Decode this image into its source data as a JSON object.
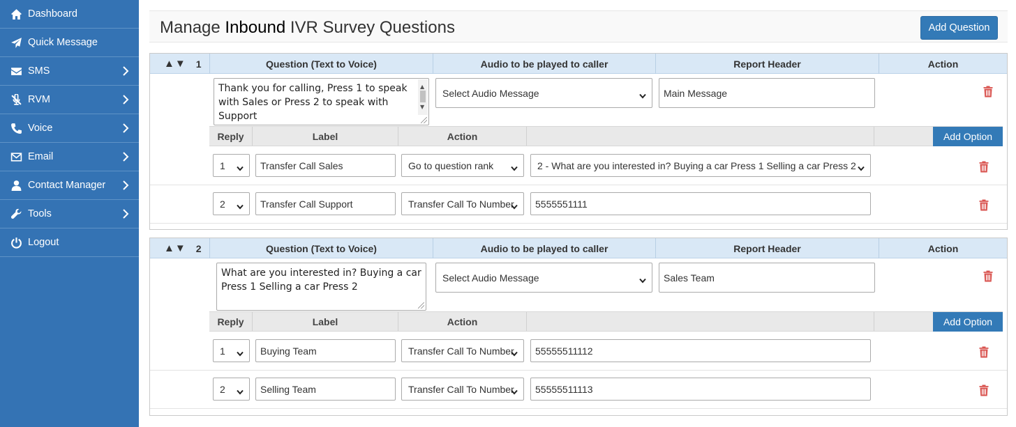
{
  "sidebar": {
    "items": [
      {
        "label": "Dashboard",
        "icon": "home-icon",
        "has_submenu": false
      },
      {
        "label": "Quick Message",
        "icon": "paper-plane-icon",
        "has_submenu": false
      },
      {
        "label": "SMS",
        "icon": "envelope-icon",
        "has_submenu": true
      },
      {
        "label": "RVM",
        "icon": "microphone-slash-icon",
        "has_submenu": true
      },
      {
        "label": "Voice",
        "icon": "phone-icon",
        "has_submenu": true
      },
      {
        "label": "Email",
        "icon": "envelope-outline-icon",
        "has_submenu": true
      },
      {
        "label": "Contact Manager",
        "icon": "user-icon",
        "has_submenu": true
      },
      {
        "label": "Tools",
        "icon": "wrench-icon",
        "has_submenu": true
      },
      {
        "label": "Logout",
        "icon": "power-icon",
        "has_submenu": false
      }
    ]
  },
  "header": {
    "title_part1": "Manage",
    "title_bold": "Inbound",
    "title_part2": "IVR Survey Questions",
    "add_question_label": "Add Question"
  },
  "columns": {
    "question": "Question (Text to Voice)",
    "audio": "Audio to be played to caller",
    "report": "Report Header",
    "action": "Action"
  },
  "option_columns": {
    "reply": "Reply",
    "label": "Label",
    "action": "Action",
    "add_option_label": "Add Option"
  },
  "questions": [
    {
      "rank": "1",
      "arrows": "▲▼",
      "text": "Thank you for calling, Press 1 to speak with Sales or Press 2 to speak with Support",
      "audio": "Select Audio Message",
      "report_header": "Main Message",
      "options": [
        {
          "reply": "1",
          "label": "Transfer Call Sales",
          "action": "Go to question rank",
          "target": "2 - What are you interested in? Buying a car Press 1 Selling a car Press 2"
        },
        {
          "reply": "2",
          "label": "Transfer Call Support",
          "action": "Transfer Call To Number",
          "target": "5555551111"
        }
      ]
    },
    {
      "rank": "2",
      "arrows": "▲▼",
      "text": "What are you interested in? Buying a car Press 1 Selling a car Press 2",
      "audio": "Select Audio Message",
      "report_header": "Sales Team",
      "options": [
        {
          "reply": "1",
          "label": "Buying Team",
          "action": "Transfer Call To Number",
          "target": "55555511112"
        },
        {
          "reply": "2",
          "label": "Selling Team",
          "action": "Transfer Call To Number",
          "target": "55555511113"
        }
      ]
    }
  ],
  "colors": {
    "sidebar_bg": "#3473b4",
    "primary_button": "#337ab7",
    "delete_icon": "#d9534f",
    "question_header_bg": "#d9e8f6"
  }
}
